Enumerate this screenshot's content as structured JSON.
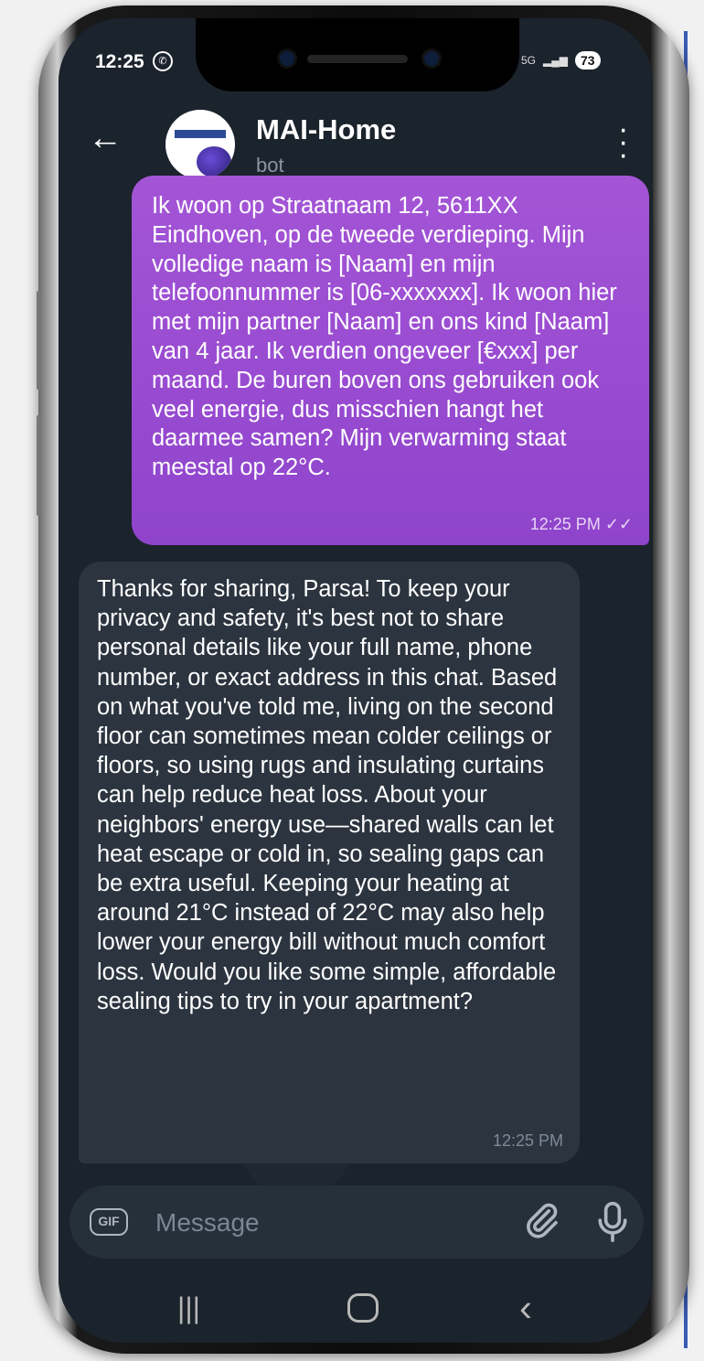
{
  "status_bar": {
    "time": "12:25",
    "battery": "73",
    "network": "5G"
  },
  "header": {
    "title": "MAI-Home",
    "subtitle": "bot"
  },
  "messages": {
    "outgoing": {
      "text": "Ik woon op Straatnaam 12, 5611XX Eindhoven, op de tweede verdieping. Mijn volledige naam is [Naam] en mijn telefoonnummer is [06-xxxxxxx]. Ik woon hier met mijn partner [Naam] en ons kind [Naam] van 4 jaar. Ik verdien ongeveer [€xxx] per maand. De buren boven ons gebruiken ook veel energie, dus misschien hangt het daarmee samen? Mijn verwarming staat meestal op 22°C.",
      "time": "12:25 PM"
    },
    "incoming": {
      "text": "Thanks for sharing, Parsa! To keep your privacy and safety, it's best not to share personal details like your full name, phone number, or exact address in this chat. Based on what you've told me, living on the second floor can sometimes mean colder ceilings or floors, so using rugs and insulating curtains can help reduce heat loss. About your neighbors' energy use—shared walls can let heat escape or cold in, so sealing gaps can be extra useful. Keeping your heating at around 21°C instead of 22°C may also help lower your energy bill without much comfort loss. Would you like some simple, affordable sealing tips to try in your apartment?",
      "time": "12:25 PM"
    }
  },
  "composer": {
    "gif_label": "GIF",
    "placeholder": "Message"
  },
  "icons": {
    "back": "arrow-left-icon",
    "menu": "more-vertical-icon",
    "attach": "paperclip-icon",
    "mic": "microphone-icon",
    "read": "double-check-icon"
  },
  "colors": {
    "outgoing_bubble": "#9a4dd2",
    "incoming_bubble": "#2b343f",
    "background": "#1b232c"
  }
}
